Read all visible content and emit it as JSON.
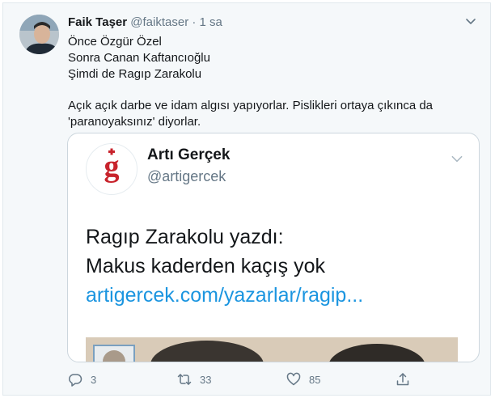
{
  "tweet": {
    "author": {
      "display_name": "Faik Taşer",
      "handle": "@faiktaser",
      "separator": "·",
      "time": "1 sa"
    },
    "text_lines": [
      "Önce Özgür Özel",
      "Sonra Canan Kaftancıoğlu",
      "Şimdi de Ragıp Zarakolu",
      "Açık açık darbe ve idam algısı yapıyorlar. Pislikleri ortaya çıkınca da",
      "'paranoyaksınız' diyorlar."
    ],
    "quoted": {
      "display_name": "Artı Gerçek",
      "handle": "@artigercek",
      "logo_letter": "g",
      "lines": [
        "Ragıp Zarakolu yazdı:",
        "Makus kaderden kaçış yok"
      ],
      "link": "artigercek.com/yazarlar/ragip..."
    },
    "actions": {
      "replies": "3",
      "retweets": "33",
      "likes": "85"
    },
    "icons": {
      "chevron": "chevron-down-icon",
      "reply": "reply-icon",
      "retweet": "retweet-icon",
      "like": "heart-icon",
      "share": "share-icon"
    },
    "colors": {
      "background": "#f5f8fa",
      "link": "#1b95e0",
      "muted": "#657786",
      "logo_red": "#c8232c"
    }
  }
}
